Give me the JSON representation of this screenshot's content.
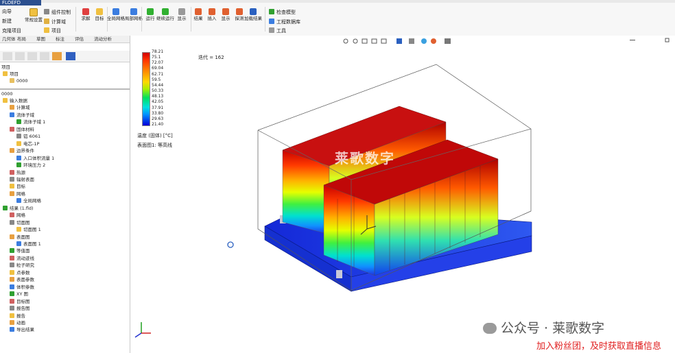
{
  "ribbon": {
    "logo": "FLOEFD",
    "wizard_label": "向导",
    "new_label": "新建",
    "clone_label": "克隆项目",
    "general_settings": "常规设置",
    "component_control": "组件控制",
    "computational_domain": "计算域",
    "project": "项目",
    "calculate": "求解",
    "goals": "目标",
    "global_mesh": "全局网格",
    "local_mesh": "局部网格",
    "run": "运行",
    "continue_run": "继续运行",
    "display": "显示",
    "results": "结果",
    "insert": "插入",
    "show": "显示",
    "probe": "探测",
    "load_results": "加载结果",
    "check_model": "检查模型",
    "engineering_db": "工程数据库",
    "tools": "工具"
  },
  "left_panel": {
    "tabs": [
      "几何体",
      "布局",
      "草图",
      "标注",
      "评估",
      "流动分析"
    ],
    "project_header": "项目",
    "project_name": "项目",
    "config": "0000",
    "analysis_header": "0000",
    "tree": [
      {
        "label": "输入数据",
        "indent": 0
      },
      {
        "label": "计算域",
        "indent": 1
      },
      {
        "label": "流体子域",
        "indent": 1
      },
      {
        "label": "流体子域 1",
        "indent": 2
      },
      {
        "label": "固体材料",
        "indent": 1
      },
      {
        "label": "铝 6061",
        "indent": 2
      },
      {
        "label": "电芯-1P",
        "indent": 2
      },
      {
        "label": "边界条件",
        "indent": 1
      },
      {
        "label": "入口体积流量 1",
        "indent": 2
      },
      {
        "label": "环境压力 2",
        "indent": 2
      },
      {
        "label": "热源",
        "indent": 1
      },
      {
        "label": "辐射表面",
        "indent": 1
      },
      {
        "label": "目标",
        "indent": 1
      },
      {
        "label": "网格",
        "indent": 1
      },
      {
        "label": "全局网格",
        "indent": 2
      },
      {
        "label": "结果 (1.fld)",
        "indent": 0
      },
      {
        "label": "网格",
        "indent": 1
      },
      {
        "label": "切面图",
        "indent": 1
      },
      {
        "label": "切面图 1",
        "indent": 2
      },
      {
        "label": "表面图",
        "indent": 1
      },
      {
        "label": "表面图 1",
        "indent": 2
      },
      {
        "label": "等值面",
        "indent": 1
      },
      {
        "label": "流动迹线",
        "indent": 1
      },
      {
        "label": "粒子研究",
        "indent": 1
      },
      {
        "label": "点参数",
        "indent": 1
      },
      {
        "label": "表面参数",
        "indent": 1
      },
      {
        "label": "体积参数",
        "indent": 1
      },
      {
        "label": "XY 图",
        "indent": 1
      },
      {
        "label": "目标图",
        "indent": 1
      },
      {
        "label": "报告图",
        "indent": 1
      },
      {
        "label": "报告",
        "indent": 1
      },
      {
        "label": "动画",
        "indent": 1
      },
      {
        "label": "导出结果",
        "indent": 1
      }
    ]
  },
  "viewport": {
    "iteration_label": "迭代 = 162",
    "legend_ticks": [
      "78.21",
      "75.1",
      "72.07",
      "69.04",
      "62.71",
      "59.5",
      "54.44",
      "50.33",
      "48.13",
      "42.05",
      "37.91",
      "33.80",
      "29.63",
      "21.40"
    ],
    "legend_units": "温度 (固体) [°C]",
    "legend_plot_name": "表面图1: 等高线",
    "watermark": "莱歌数字",
    "wechat_text": "公众号 · 莱歌数字",
    "promo_text": "加入粉丝团，及时获取直播信息"
  },
  "colors": {
    "hot": "#cc0000",
    "cold": "#0000cc",
    "base": "#1a3fe0",
    "promo": "#e02020"
  }
}
